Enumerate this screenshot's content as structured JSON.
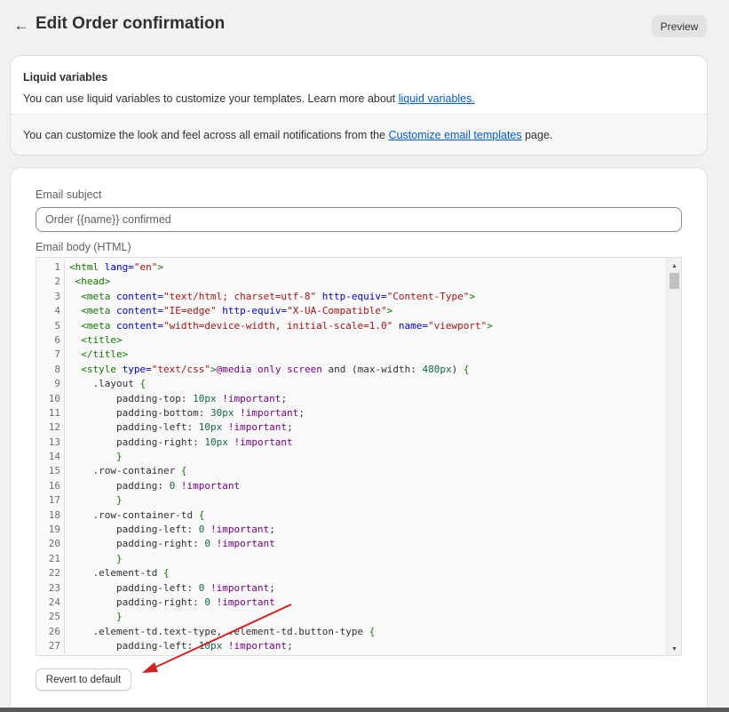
{
  "header": {
    "back_icon": "arrow-left-icon",
    "back_glyph": "←",
    "title": "Edit Order confirmation",
    "preview_label": "Preview"
  },
  "liquid": {
    "title": "Liquid variables",
    "text_prefix": "You can use liquid variables to customize your templates. Learn more about ",
    "text_link": "liquid variables.",
    "footer_prefix": "You can customize the look and feel across all email notifications from the ",
    "footer_link": "Customize email templates",
    "footer_suffix": " page."
  },
  "email": {
    "subject_label": "Email subject",
    "subject_value": "Order {{name}} confirmed",
    "body_label": "Email body (HTML)",
    "revert_label": "Revert to default"
  },
  "code": {
    "lines": [
      [
        [
          "t",
          "<html "
        ],
        [
          "a",
          "lang="
        ],
        [
          "s",
          "\"en\""
        ],
        [
          "t",
          ">"
        ]
      ],
      [
        [
          "p",
          " "
        ],
        [
          "t",
          "<head>"
        ]
      ],
      [
        [
          "p",
          "  "
        ],
        [
          "t",
          "<meta "
        ],
        [
          "a",
          "content="
        ],
        [
          "s",
          "\"text/html; charset=utf-8\""
        ],
        [
          "p",
          " "
        ],
        [
          "a",
          "http-equiv="
        ],
        [
          "s",
          "\"Content-Type\""
        ],
        [
          "t",
          ">"
        ]
      ],
      [
        [
          "p",
          "  "
        ],
        [
          "t",
          "<meta "
        ],
        [
          "a",
          "content="
        ],
        [
          "s",
          "\"IE=edge\""
        ],
        [
          "p",
          " "
        ],
        [
          "a",
          "http-equiv="
        ],
        [
          "s",
          "\"X-UA-Compatible\""
        ],
        [
          "t",
          ">"
        ]
      ],
      [
        [
          "p",
          "  "
        ],
        [
          "t",
          "<meta "
        ],
        [
          "a",
          "content="
        ],
        [
          "s",
          "\"width=device-width, initial-scale=1.0\""
        ],
        [
          "p",
          " "
        ],
        [
          "a",
          "name="
        ],
        [
          "s",
          "\"viewport\""
        ],
        [
          "t",
          ">"
        ]
      ],
      [
        [
          "p",
          "  "
        ],
        [
          "t",
          "<title>"
        ]
      ],
      [
        [
          "p",
          "  "
        ],
        [
          "t",
          "</title>"
        ]
      ],
      [
        [
          "p",
          "  "
        ],
        [
          "t",
          "<style "
        ],
        [
          "a",
          "type="
        ],
        [
          "s",
          "\"text/css\""
        ],
        [
          "t",
          ">"
        ],
        [
          "k",
          "@media"
        ],
        [
          "p",
          " "
        ],
        [
          "k",
          "only"
        ],
        [
          "p",
          " "
        ],
        [
          "k",
          "screen"
        ],
        [
          "p",
          " and ("
        ],
        [
          "p",
          "max-width"
        ],
        [
          "p",
          ": "
        ],
        [
          "n",
          "480px"
        ],
        [
          "p",
          ") "
        ],
        [
          "t",
          "{"
        ]
      ],
      [
        [
          "p",
          "    .layout "
        ],
        [
          "t",
          "{"
        ]
      ],
      [
        [
          "p",
          "        padding-top: "
        ],
        [
          "n",
          "10px"
        ],
        [
          "p",
          " "
        ],
        [
          "k",
          "!important"
        ],
        [
          "p",
          ";"
        ]
      ],
      [
        [
          "p",
          "        padding-bottom: "
        ],
        [
          "n",
          "30px"
        ],
        [
          "p",
          " "
        ],
        [
          "k",
          "!important"
        ],
        [
          "p",
          ";"
        ]
      ],
      [
        [
          "p",
          "        padding-left: "
        ],
        [
          "n",
          "10px"
        ],
        [
          "p",
          " "
        ],
        [
          "k",
          "!important"
        ],
        [
          "p",
          ";"
        ]
      ],
      [
        [
          "p",
          "        padding-right: "
        ],
        [
          "n",
          "10px"
        ],
        [
          "p",
          " "
        ],
        [
          "k",
          "!important"
        ]
      ],
      [
        [
          "p",
          "        "
        ],
        [
          "t",
          "}"
        ]
      ],
      [
        [
          "p",
          "    .row-container "
        ],
        [
          "t",
          "{"
        ]
      ],
      [
        [
          "p",
          "        padding: "
        ],
        [
          "n",
          "0"
        ],
        [
          "p",
          " "
        ],
        [
          "k",
          "!important"
        ]
      ],
      [
        [
          "p",
          "        "
        ],
        [
          "t",
          "}"
        ]
      ],
      [
        [
          "p",
          "    .row-container-td "
        ],
        [
          "t",
          "{"
        ]
      ],
      [
        [
          "p",
          "        padding-left: "
        ],
        [
          "n",
          "0"
        ],
        [
          "p",
          " "
        ],
        [
          "k",
          "!important"
        ],
        [
          "p",
          ";"
        ]
      ],
      [
        [
          "p",
          "        padding-right: "
        ],
        [
          "n",
          "0"
        ],
        [
          "p",
          " "
        ],
        [
          "k",
          "!important"
        ]
      ],
      [
        [
          "p",
          "        "
        ],
        [
          "t",
          "}"
        ]
      ],
      [
        [
          "p",
          "    .element-td "
        ],
        [
          "t",
          "{"
        ]
      ],
      [
        [
          "p",
          "        padding-left: "
        ],
        [
          "n",
          "0"
        ],
        [
          "p",
          " "
        ],
        [
          "k",
          "!important"
        ],
        [
          "p",
          ";"
        ]
      ],
      [
        [
          "p",
          "        padding-right: "
        ],
        [
          "n",
          "0"
        ],
        [
          "p",
          " "
        ],
        [
          "k",
          "!important"
        ]
      ],
      [
        [
          "p",
          "        "
        ],
        [
          "t",
          "}"
        ]
      ],
      [
        [
          "p",
          "    .element-td.text-type, .element-td.button-type "
        ],
        [
          "t",
          "{"
        ]
      ],
      [
        [
          "p",
          "        padding-left: "
        ],
        [
          "n",
          "10px"
        ],
        [
          "p",
          " "
        ],
        [
          "k",
          "!important"
        ],
        [
          "p",
          ";"
        ]
      ]
    ]
  },
  "colors": {
    "accent_link": "#005bd3",
    "annotation_arrow": "#d42020"
  }
}
